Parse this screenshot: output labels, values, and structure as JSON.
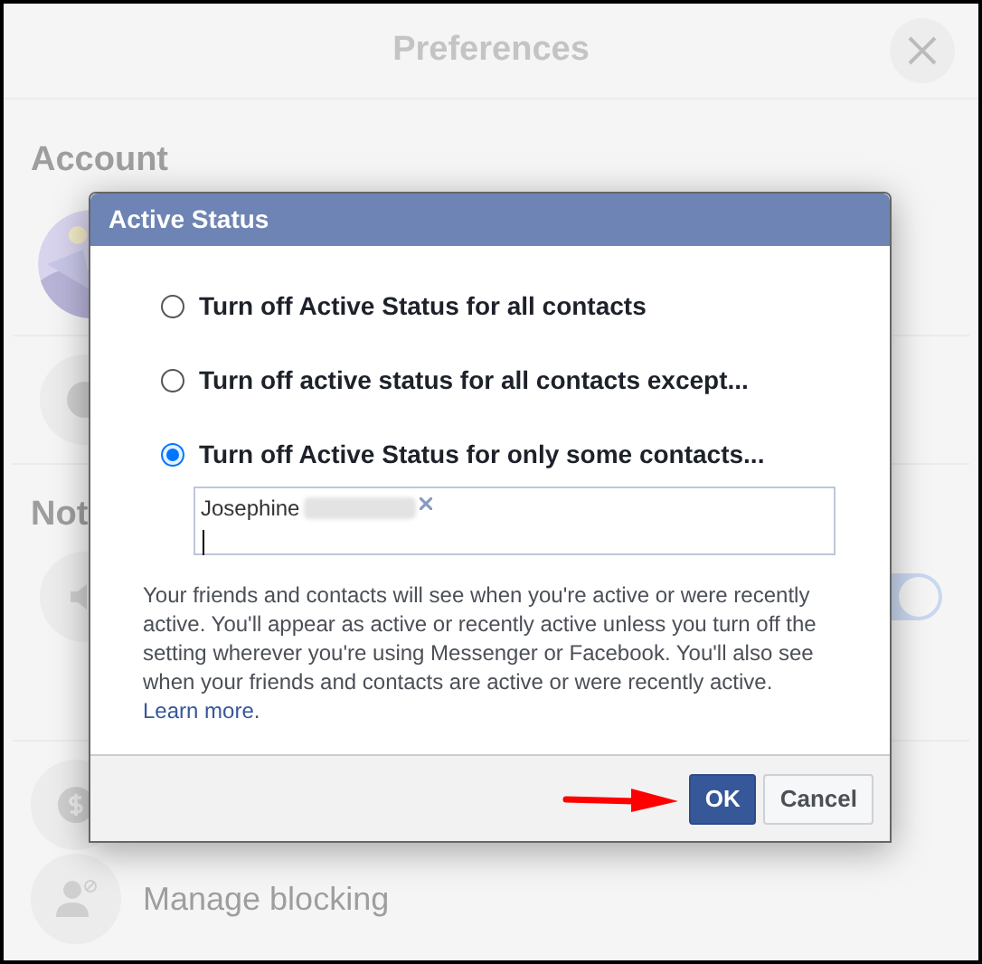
{
  "preferences": {
    "title": "Preferences",
    "sections": [
      {
        "heading": "Account"
      },
      {
        "heading": "Not"
      }
    ],
    "notification_toggle": {
      "on": true
    },
    "manage_blocking": "Manage blocking"
  },
  "dialog": {
    "title": "Active Status",
    "options": [
      {
        "label": "Turn off Active Status for all contacts",
        "selected": false
      },
      {
        "label": "Turn off active status for all contacts except...",
        "selected": false
      },
      {
        "label": "Turn off Active Status for only some contacts...",
        "selected": true
      }
    ],
    "tokens": [
      {
        "name": "Josephine"
      }
    ],
    "description": "Your friends and contacts will see when you're active or were recently active. You'll appear as active or recently active unless you turn off the setting wherever you're using Messenger or Facebook. You'll also see when your friends and contacts are active or were recently active.",
    "link": "Learn more",
    "after_link": ".",
    "buttons": [
      {
        "label": "OK",
        "kind": "primary"
      },
      {
        "label": "Cancel",
        "kind": "secondary"
      }
    ]
  }
}
